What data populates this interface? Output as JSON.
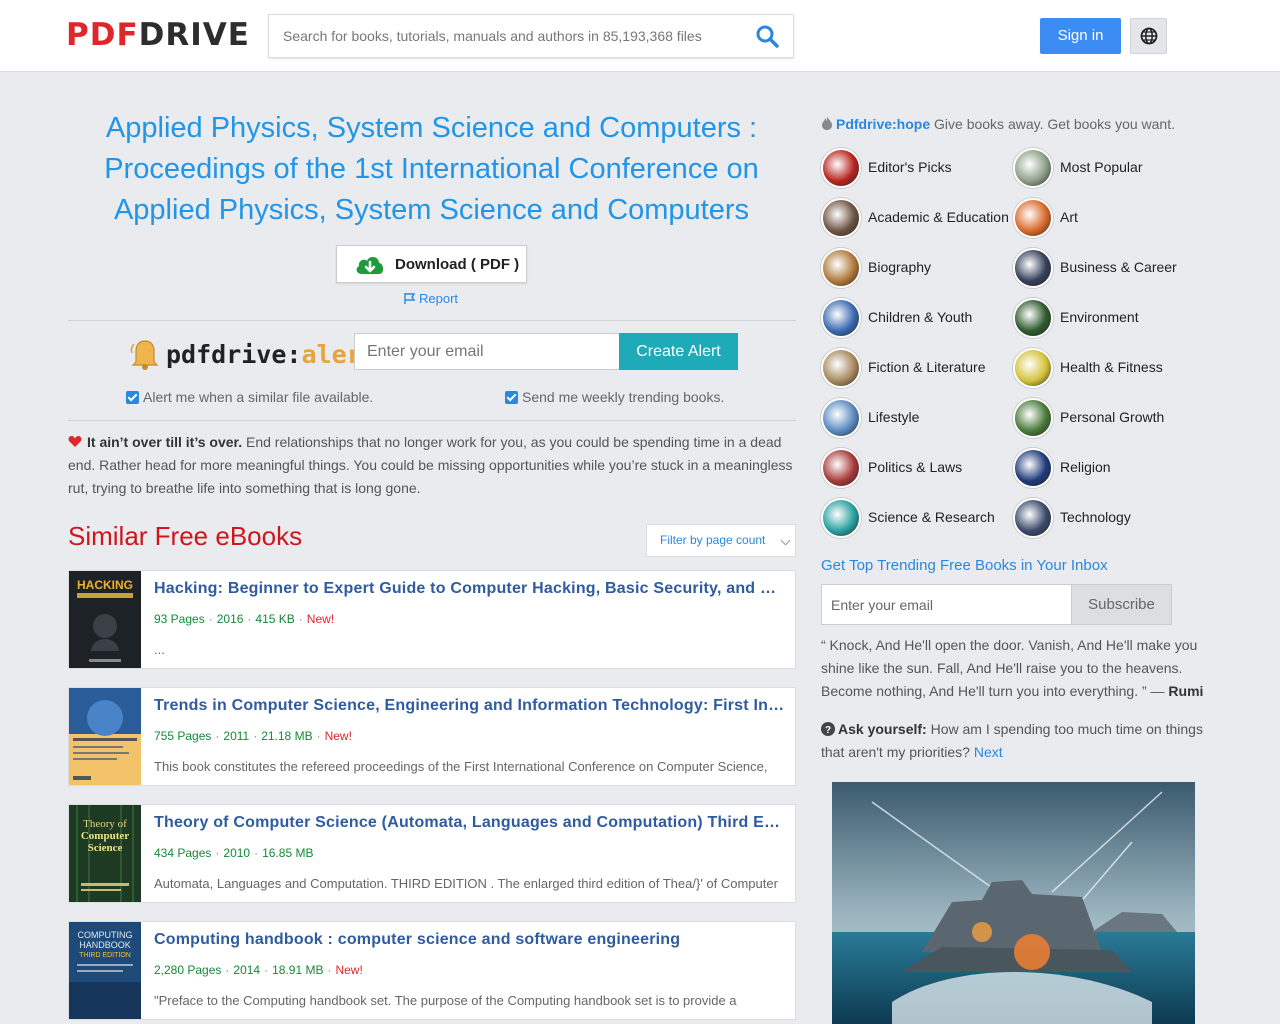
{
  "header": {
    "logo_pdf": "PDF",
    "logo_drive": "DRIVE",
    "search_placeholder": "Search for books, tutorials, manuals and authors in 85,193,368 files",
    "signin_label": "Sign in",
    "accent": "#3c8cf4"
  },
  "book": {
    "title": "Applied Physics, System Science and Computers : Proceedings of the 1st International Conference on Applied Physics, System Science and Computers",
    "download_label": "Download ( PDF )",
    "report_label": "Report"
  },
  "alerts": {
    "logo_a": "pdfdrive:",
    "logo_b": "alerts",
    "email_placeholder": "Enter your email",
    "create_label": "Create Alert",
    "check1": "Alert me when a similar file available.",
    "check2": "Send me weekly trending books."
  },
  "quote": {
    "bold": "It ain’t over till it’s over.",
    "text": "End relationships that no longer work for you, as you could be spending time in a dead end. Rather head for more meaningful things. You could be missing opportunities while you’re stuck in a meaningless rut, trying to breathe life into something that is long gone."
  },
  "similar": {
    "heading": "Similar Free eBooks",
    "filter_label": "Filter by page count",
    "items": [
      {
        "title": "Hacking: Beginner to Expert Guide to Computer Hacking, Basic Security, and Penetration Testing",
        "pages": "93 Pages",
        "year": "2016",
        "size": "415 KB",
        "new": "New!",
        "desc": " ..."
      },
      {
        "title": "Trends in Computer Science, Engineering and Information Technology: First International Conference",
        "pages": "755 Pages",
        "year": "2011",
        "size": "21.18 MB",
        "new": "New!",
        "desc": "This book constitutes the refereed proceedings of the First International Conference on Computer Science,"
      },
      {
        "title": "Theory of Computer Science (Automata, Languages and Computation) Third Edition",
        "pages": "434 Pages",
        "year": "2010",
        "size": "16.85 MB",
        "new": "",
        "desc": "Automata, Languages and Computation. THIRD EDITION . The enlarged third edition of Thea/}' of Computer"
      },
      {
        "title": "Computing handbook : computer science and software engineering",
        "pages": "2,280 Pages",
        "year": "2014",
        "size": "18.91 MB",
        "new": "New!",
        "desc": "\"Preface to the Computing handbook set. The purpose of the Computing handbook set is to provide a"
      }
    ]
  },
  "sidebar": {
    "hope_link": "Pdfdrive:hope",
    "hope_text": " Give books away. Get books you want.",
    "categories": [
      {
        "label": "Editor's Picks",
        "icon": "editors-picks-icon",
        "color": "#b8251f"
      },
      {
        "label": "Most Popular",
        "icon": "most-popular-icon",
        "color": "#8fa089"
      },
      {
        "label": "Academic & Education",
        "icon": "academic-icon",
        "color": "#6e5442"
      },
      {
        "label": "Art",
        "icon": "art-icon",
        "color": "#d9692a"
      },
      {
        "label": "Biography",
        "icon": "biography-icon",
        "color": "#b07a3a"
      },
      {
        "label": "Business & Career",
        "icon": "business-icon",
        "color": "#34405a"
      },
      {
        "label": "Children & Youth",
        "icon": "children-icon",
        "color": "#3a6ab0"
      },
      {
        "label": "Environment",
        "icon": "environment-icon",
        "color": "#2e5a2e"
      },
      {
        "label": "Fiction & Literature",
        "icon": "fiction-icon",
        "color": "#a88a60"
      },
      {
        "label": "Health & Fitness",
        "icon": "health-icon",
        "color": "#d4c23a"
      },
      {
        "label": "Lifestyle",
        "icon": "lifestyle-icon",
        "color": "#5a8ac0"
      },
      {
        "label": "Personal Growth",
        "icon": "personal-growth-icon",
        "color": "#4a7a3a"
      },
      {
        "label": "Politics & Laws",
        "icon": "politics-icon",
        "color": "#a83a3a"
      },
      {
        "label": "Religion",
        "icon": "religion-icon",
        "color": "#1e3a7a"
      },
      {
        "label": "Science & Research",
        "icon": "science-icon",
        "color": "#2aa0a0"
      },
      {
        "label": "Technology",
        "icon": "technology-icon",
        "color": "#3a4a6a"
      }
    ],
    "trend_heading": "Get Top Trending Free Books in Your Inbox",
    "sub_placeholder": "Enter your email",
    "sub_label": "Subscribe",
    "rumi_quote": "“ Knock, And He'll open the door. Vanish, And He'll make you shine like the sun. Fall, And He'll raise you to the heavens. Become nothing, And He'll turn you into everything. ” —",
    "rumi_author": "Rumi",
    "ask_bold": "Ask yourself:",
    "ask_text": " How am I spending too much time on things that aren't my priorities?",
    "ask_next": "Next"
  }
}
